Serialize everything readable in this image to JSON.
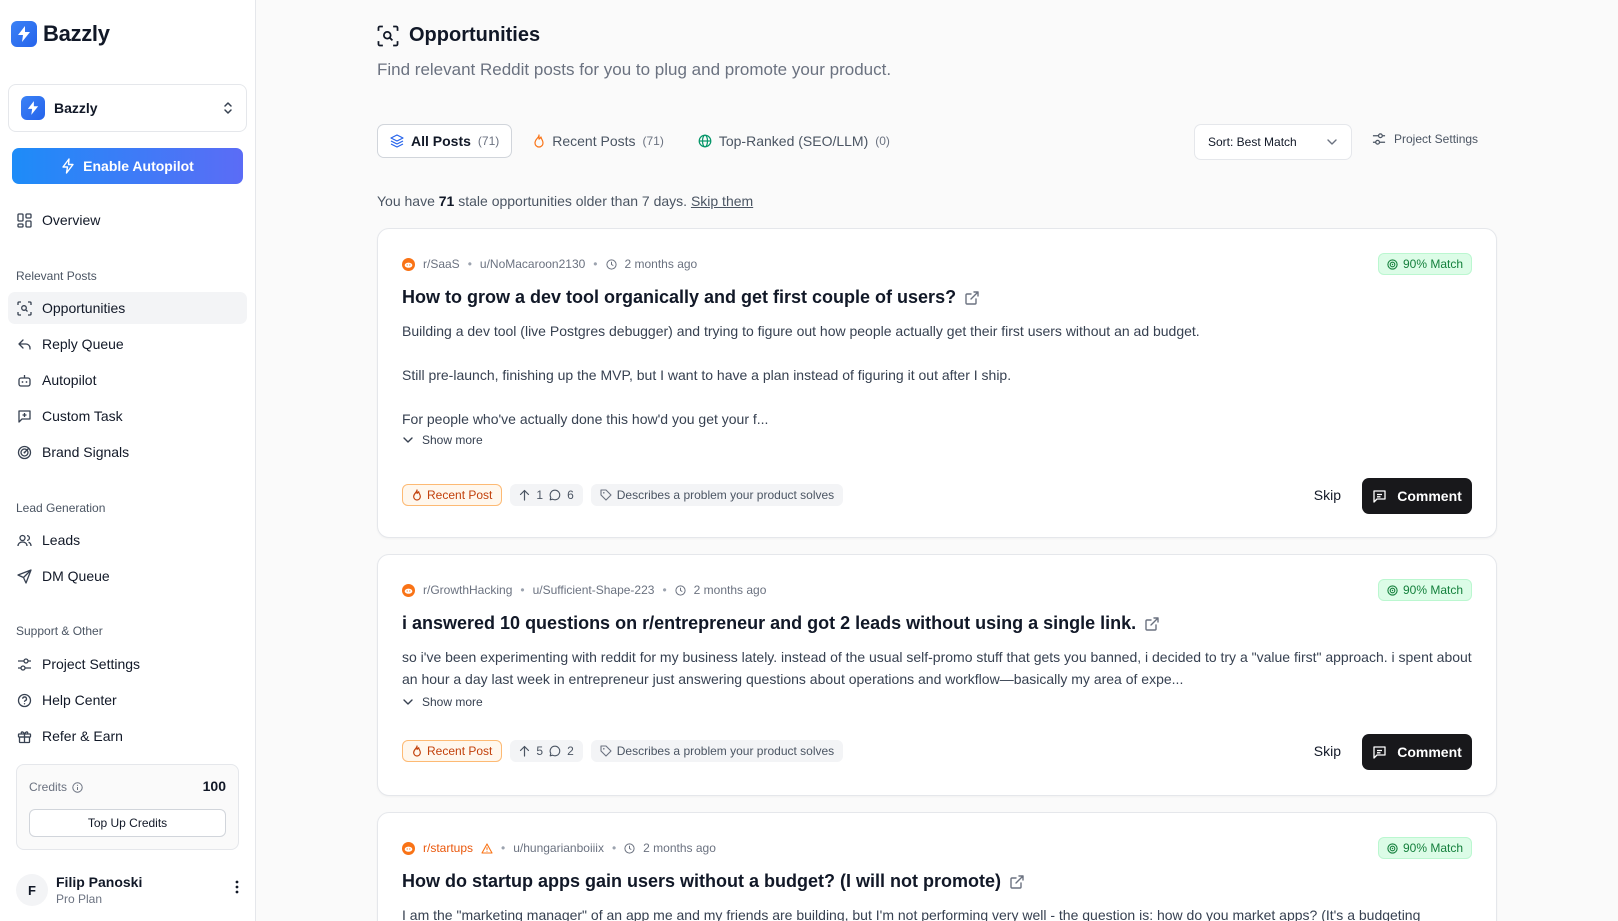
{
  "app": {
    "name": "Bazzly"
  },
  "workspace": {
    "name": "Bazzly"
  },
  "sidebar": {
    "autopilot_label": "Enable Autopilot",
    "overview": "Overview",
    "sections": {
      "relevant": "Relevant Posts",
      "lead": "Lead Generation",
      "support": "Support & Other"
    },
    "items": {
      "opportunities": "Opportunities",
      "reply_queue": "Reply Queue",
      "autopilot": "Autopilot",
      "custom_task": "Custom Task",
      "brand_signals": "Brand Signals",
      "leads": "Leads",
      "dm_queue": "DM Queue",
      "project_settings": "Project Settings",
      "help_center": "Help Center",
      "refer_earn": "Refer & Earn"
    },
    "credits": {
      "label": "Credits",
      "value": "100",
      "topup_label": "Top Up Credits"
    },
    "user": {
      "initial": "F",
      "name": "Filip Panoski",
      "plan": "Pro Plan"
    }
  },
  "header": {
    "title": "Opportunities",
    "subtitle": "Find relevant Reddit posts for you to plug and promote your product."
  },
  "tabs": [
    {
      "label": "All Posts",
      "count": "(71)",
      "active": true
    },
    {
      "label": "Recent Posts",
      "count": "(71)",
      "active": false
    },
    {
      "label": "Top-Ranked (SEO/LLM)",
      "count": "(0)",
      "active": false
    }
  ],
  "sort": {
    "label": "Sort: Best Match"
  },
  "project_settings_label": "Project Settings",
  "stale": {
    "prefix": "You have",
    "count": "71",
    "suffix": "stale opportunities older than 7 days.",
    "link": "Skip them"
  },
  "posts": [
    {
      "subreddit": "r/SaaS",
      "author": "u/NoMacaroon2130",
      "time": "2 months ago",
      "match": "90% Match",
      "title": "How to grow a dev tool organically and get first couple of users?",
      "body": [
        "Building a dev tool (live Postgres debugger) and trying to figure out how people actually get their first users without an ad budget.",
        "Still pre-launch, finishing up the MVP, but I want to have a plan instead of figuring it out after I ship.",
        "For people who've actually done this how'd you get your f..."
      ],
      "show_more": "Show more",
      "badge": "Recent Post",
      "upvotes": "1",
      "comments": "6",
      "tag": "Describes a problem your product solves",
      "skip": "Skip",
      "comment": "Comment"
    },
    {
      "subreddit": "r/GrowthHacking",
      "author": "u/Sufficient-Shape-223",
      "time": "2 months ago",
      "match": "90% Match",
      "title": "i answered 10 questions on r/entrepreneur and got 2 leads without using a single link.",
      "body": [
        "so i've been experimenting with reddit for my business lately. instead of the usual self-promo stuff that gets you banned, i decided to try a \"value first\" approach. i spent about an hour a day last week in entrepreneur just answering questions about operations and workflow—basically my area of expe..."
      ],
      "show_more": "Show more",
      "badge": "Recent Post",
      "upvotes": "5",
      "comments": "2",
      "tag": "Describes a problem your product solves",
      "skip": "Skip",
      "comment": "Comment"
    },
    {
      "subreddit": "r/startups",
      "author": "u/hungarianboiiix",
      "time": "2 months ago",
      "match": "90% Match",
      "title": "How do startup apps gain users without a budget? (I will not promote)",
      "body": [
        "I am the \"marketing manager\" of an app me and my friends are building, but I'm not performing very well - the question is: how do you market apps? (It's a budgeting"
      ]
    }
  ],
  "colors": {
    "accent": "#1d8cf8",
    "match_green": "#15803d",
    "recent_orange": "#c2410c",
    "reddit_orange": "#f97316"
  }
}
